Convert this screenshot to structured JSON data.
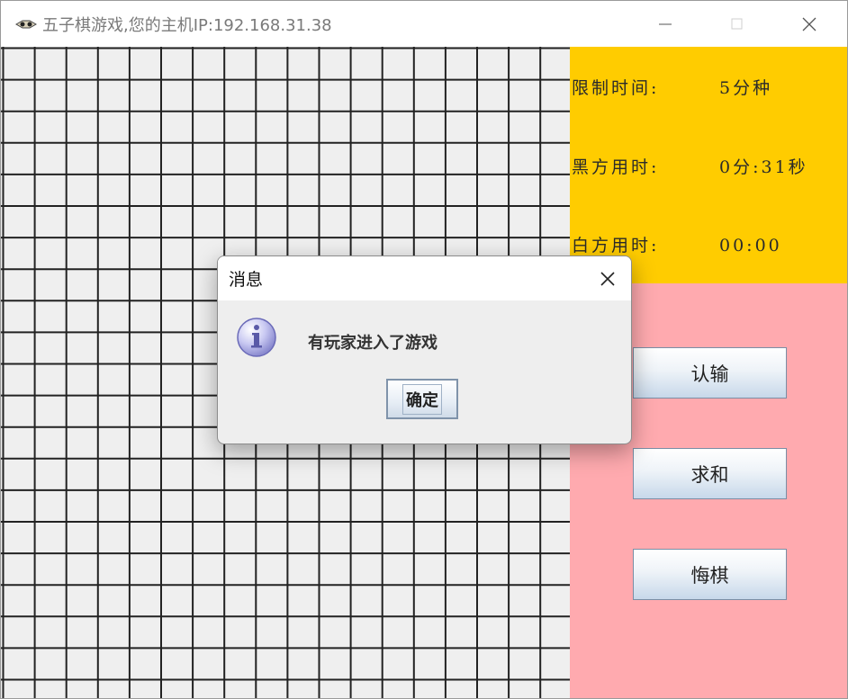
{
  "window": {
    "title": "五子棋游戏,您的主机IP:192.168.31.38"
  },
  "info": [
    {
      "label": "限制时间:",
      "value": "5分种"
    },
    {
      "label": "黑方用时:",
      "value": "0分:31秒"
    },
    {
      "label": "白方用时:",
      "value": "00:00"
    }
  ],
  "buttons": {
    "resign": "认输",
    "draw": "求和",
    "undo": "悔棋"
  },
  "dialog": {
    "title": "消息",
    "message": "有玩家进入了游戏",
    "ok": "确定"
  },
  "colors": {
    "info_panel": "#ffcc00",
    "button_panel": "#ffaaaf",
    "board": "#efefef",
    "grid_line": "#222222"
  }
}
